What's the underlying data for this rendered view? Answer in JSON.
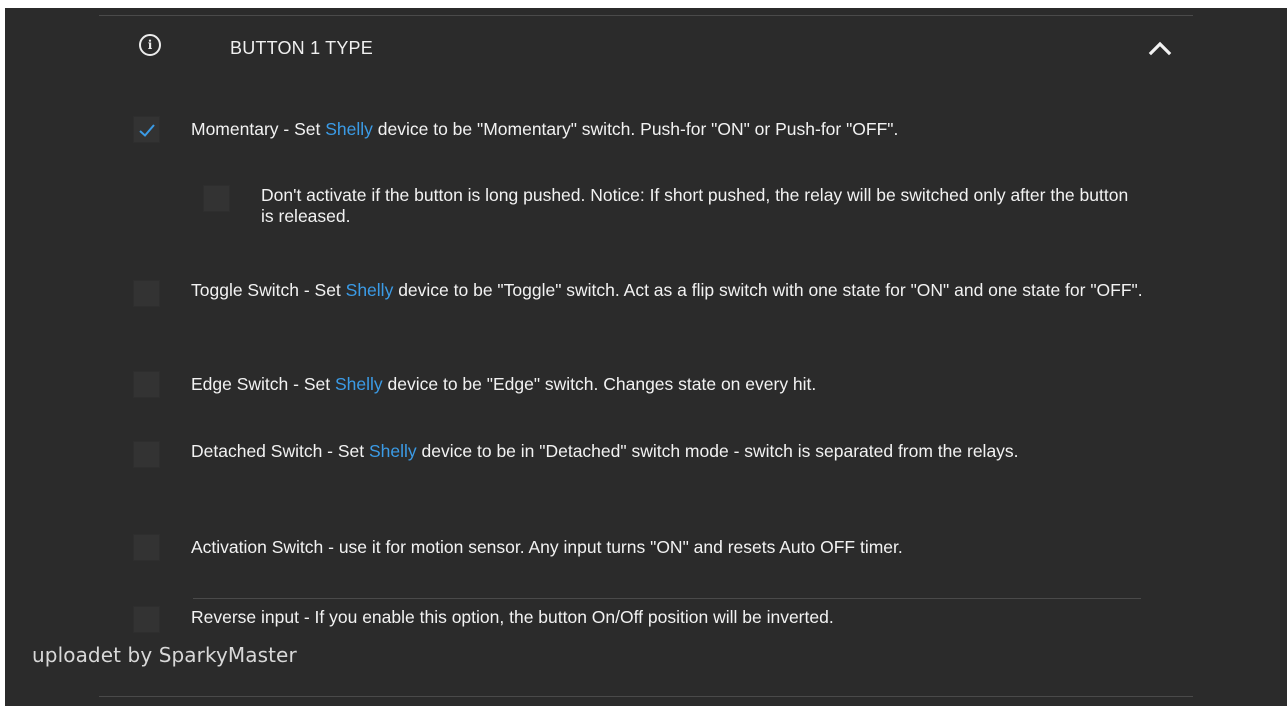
{
  "header": {
    "title": "BUTTON 1 TYPE",
    "info_icon": "info-circle-icon",
    "collapse_icon": "chevron-up-icon"
  },
  "options": [
    {
      "checked": true,
      "text_before": "Momentary - Set ",
      "brand": "Shelly",
      "text_after": " device to be \"Momentary\" switch. Push-for \"ON\" or Push-for \"OFF\"."
    },
    {
      "checked": false,
      "text": "Don't activate if the button is long pushed. Notice: If short pushed, the relay will be switched only after the button is released."
    },
    {
      "checked": false,
      "text_before": "Toggle Switch - Set ",
      "brand": "Shelly",
      "text_after": " device to be \"Toggle\" switch. Act as a flip switch with one state for \"ON\" and one state for \"OFF\"."
    },
    {
      "checked": false,
      "text_before": "Edge Switch - Set ",
      "brand": "Shelly",
      "text_after": " device to be \"Edge\" switch. Changes state on every hit."
    },
    {
      "checked": false,
      "text_before": "Detached Switch - Set ",
      "brand": "Shelly",
      "text_after": " device to be in \"Detached\" switch mode - switch is separated from the relays."
    },
    {
      "checked": false,
      "text": "Activation Switch - use it for motion sensor. Any input turns \"ON\" and resets Auto OFF timer."
    },
    {
      "checked": false,
      "text": "Reverse input - If you enable this option, the button On/Off position will be inverted."
    }
  ],
  "watermark": "uploadet by SparkyMaster",
  "colors": {
    "panel_bg": "#2b2b2b",
    "checkbox_bg": "#333333",
    "accent": "#3b9be6",
    "text": "#f2f2f2"
  }
}
